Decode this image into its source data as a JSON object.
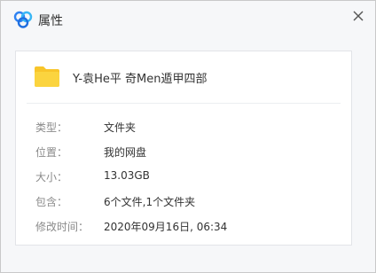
{
  "window": {
    "title": "属性",
    "app_icon": "baidu-netdisk-cloud-icon",
    "close_icon": "close-icon"
  },
  "item": {
    "icon": "folder-icon",
    "icon_color": "#f8c52a",
    "name": "Y-袁He平 奇Men遁甲四部"
  },
  "properties": [
    {
      "label": "类型：",
      "value": "文件夹"
    },
    {
      "label": "位置：",
      "value": "我的网盘"
    },
    {
      "label": "大小：",
      "value": "13.03GB"
    },
    {
      "label": "包含：",
      "value": "6个文件,1个文件夹"
    },
    {
      "label": "修改时间：",
      "value": "2020年09月16日, 06:34"
    }
  ]
}
